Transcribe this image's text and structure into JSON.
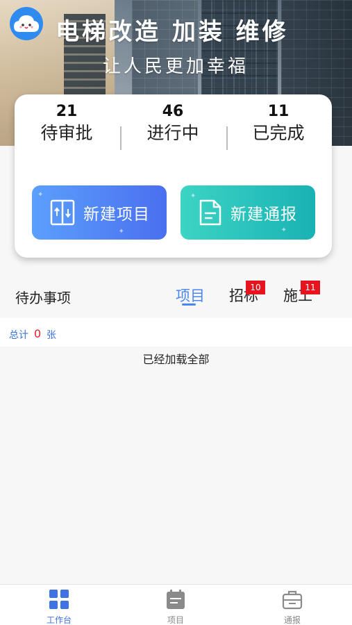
{
  "header": {
    "title": "电梯改造 加装 维修",
    "subtitle": "让人民更加幸福",
    "logo_icon": "cloud-mascot-icon"
  },
  "stats": [
    {
      "value": "21",
      "label": "待审批"
    },
    {
      "value": "46",
      "label": "进行中"
    },
    {
      "value": "11",
      "label": "已完成"
    }
  ],
  "actions": {
    "new_project": {
      "label": "新建项目",
      "icon": "elevator-icon"
    },
    "new_report": {
      "label": "新建通报",
      "icon": "document-icon"
    }
  },
  "todo": {
    "title": "待办事项",
    "tabs": [
      {
        "label": "项目",
        "active": true
      },
      {
        "label": "招标",
        "badge": "10"
      },
      {
        "label": "施工",
        "badge": "11"
      }
    ],
    "total_label": "总计",
    "total_count": "0",
    "total_unit": "张",
    "loaded_text": "已经加载全部"
  },
  "bottom_nav": [
    {
      "label": "工作台",
      "icon": "dashboard-grid-icon",
      "active": true
    },
    {
      "label": "项目",
      "icon": "calendar-icon"
    },
    {
      "label": "通报",
      "icon": "briefcase-icon"
    }
  ],
  "colors": {
    "accent": "#4a86f0",
    "badge": "#e6141e",
    "project_button": "#4a6ff0",
    "report_button": "#19b2b4"
  }
}
